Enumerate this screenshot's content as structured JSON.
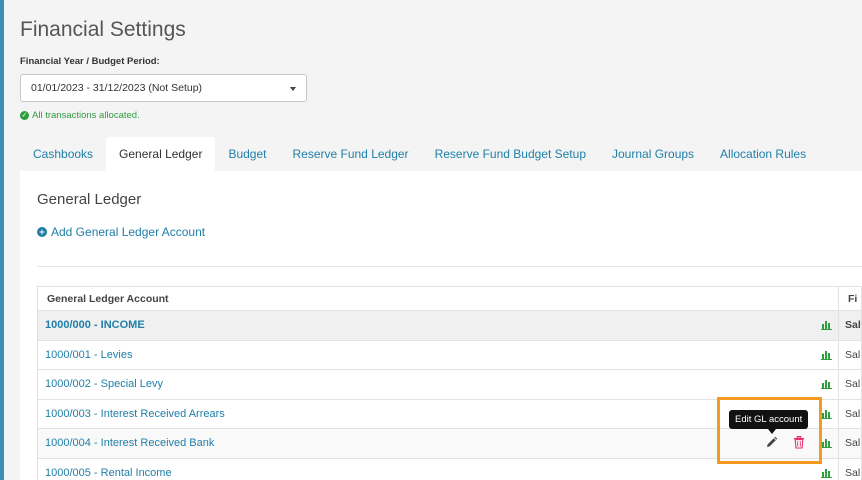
{
  "page": {
    "title": "Financial Settings"
  },
  "period": {
    "label": "Financial Year / Budget Period:",
    "selected": "01/01/2023 - 31/12/2023 (Not Setup)"
  },
  "allocation_status": "All transactions allocated.",
  "tabs": [
    {
      "label": "Cashbooks"
    },
    {
      "label": "General Ledger"
    },
    {
      "label": "Budget"
    },
    {
      "label": "Reserve Fund Ledger"
    },
    {
      "label": "Reserve Fund Budget Setup"
    },
    {
      "label": "Journal Groups"
    },
    {
      "label": "Allocation Rules"
    }
  ],
  "panel": {
    "title": "General Ledger",
    "add_link": "Add General Ledger Account"
  },
  "table": {
    "headers": [
      "General Ledger Account",
      "Fi"
    ],
    "rows": [
      {
        "name": "1000/000 - INCOME",
        "col2": "Sal"
      },
      {
        "name": "1000/001 - Levies",
        "col2": "Sal"
      },
      {
        "name": "1000/002 - Special Levy",
        "col2": "Sal"
      },
      {
        "name": "1000/003 - Interest Received Arrears",
        "col2": "Sal"
      },
      {
        "name": "1000/004 - Interest Received Bank",
        "col2": "Sal"
      },
      {
        "name": "1000/005 - Rental Income",
        "col2": "Sal"
      }
    ]
  },
  "tooltip": "Edit GL account",
  "colors": {
    "accent": "#1f7fa8",
    "success": "#2e9e3e",
    "danger": "#e8336a",
    "highlight": "#f39a1f"
  }
}
